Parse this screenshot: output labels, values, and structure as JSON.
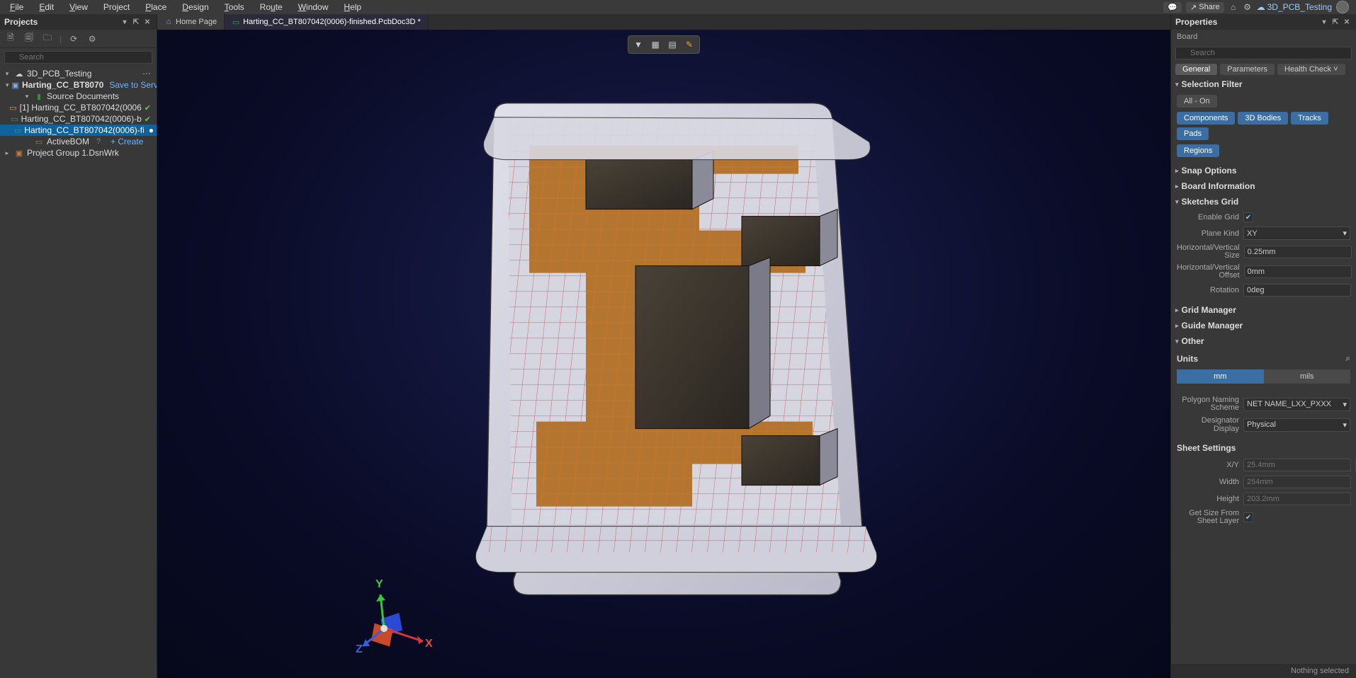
{
  "menu": {
    "items": [
      "File",
      "Edit",
      "View",
      "Project",
      "Place",
      "Design",
      "Tools",
      "Route",
      "Window",
      "Help"
    ]
  },
  "topbar": {
    "share": "Share",
    "workspace": "3D_PCB_Testing"
  },
  "left": {
    "title": "Projects",
    "search_ph": "Search",
    "tree": {
      "root": "3D_PCB_Testing",
      "proj": "Harting_CC_BT8070",
      "proj_link": "Save to Server",
      "src": "Source Documents",
      "items": [
        "[1] Harting_CC_BT807042(0006",
        "Harting_CC_BT807042(0006)-b",
        "Harting_CC_BT807042(0006)-fi"
      ],
      "activebom": "ActiveBOM",
      "create": "+ Create",
      "group": "Project Group 1.DsnWrk"
    }
  },
  "tabs": {
    "home": "Home Page",
    "doc": "Harting_CC_BT807042(0006)-finished.PcbDoc3D *"
  },
  "axes": {
    "x": "X",
    "y": "Y",
    "z": "Z"
  },
  "props": {
    "title": "Properties",
    "sub": "Board",
    "search_ph": "Search",
    "tabs": [
      "General",
      "Parameters",
      "Health Check"
    ],
    "sel_filter": "Selection Filter",
    "all_on": "All - On",
    "chips": [
      "Components",
      "3D Bodies",
      "Tracks",
      "Pads",
      "Regions"
    ],
    "snap": "Snap Options",
    "board_info": "Board Information",
    "sketches": "Sketches Grid",
    "enable_grid": "Enable Grid",
    "plane_kind": "Plane Kind",
    "plane_val": "XY",
    "hv_size": "Horizontal/Vertical Size",
    "hv_size_a": "0.25mm",
    "hv_size_b": "0.25mm",
    "hv_off": "Horizontal/Vertical Offset",
    "hv_off_a": "0mm",
    "hv_off_b": "0mm",
    "rotation": "Rotation",
    "rotation_v": "0deg",
    "grid_mgr": "Grid Manager",
    "guide_mgr": "Guide Manager",
    "other": "Other",
    "units": "Units",
    "mm": "mm",
    "mils": "mils",
    "poly": "Polygon Naming Scheme",
    "poly_v": "NET NAME_LXX_PXXX",
    "desig": "Designator Display",
    "desig_v": "Physical",
    "sheet": "Sheet Settings",
    "xy": "X/Y",
    "xy_a": "25.4mm",
    "xy_b": "25.4mm",
    "width": "Width",
    "width_v": "254mm",
    "height": "Height",
    "height_v": "203.2mm",
    "getsize": "Get Size From Sheet Layer"
  },
  "status": "Nothing selected"
}
